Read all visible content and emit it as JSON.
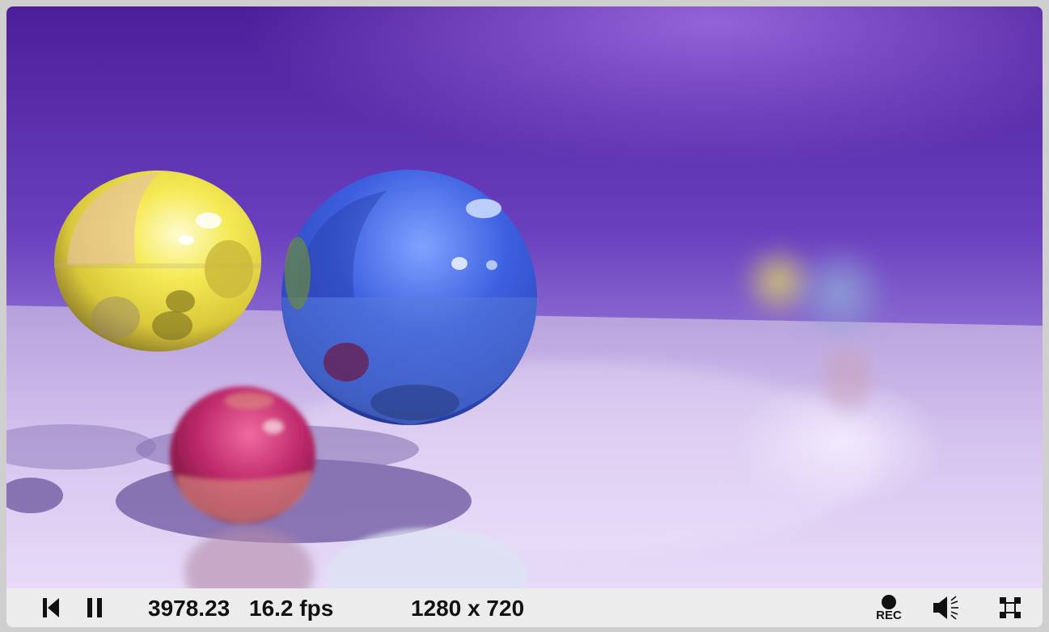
{
  "controls": {
    "time": "3978.23",
    "fps": "16.2 fps",
    "resolution": "1280 x 720",
    "rec_label": "REC"
  },
  "icons": {
    "rewind": "rewind-to-start-icon",
    "pause": "pause-icon",
    "record": "record-icon",
    "volume": "volume-icon",
    "fullscreen": "fullscreen-icon"
  },
  "colors": {
    "wall": "#5a2aa8",
    "floor": "#d9c6f0",
    "yellow_sphere": "#f2e640",
    "blue_sphere": "#3f63d8",
    "red_sphere": "#c0306a",
    "control_bar": "#ececec"
  }
}
